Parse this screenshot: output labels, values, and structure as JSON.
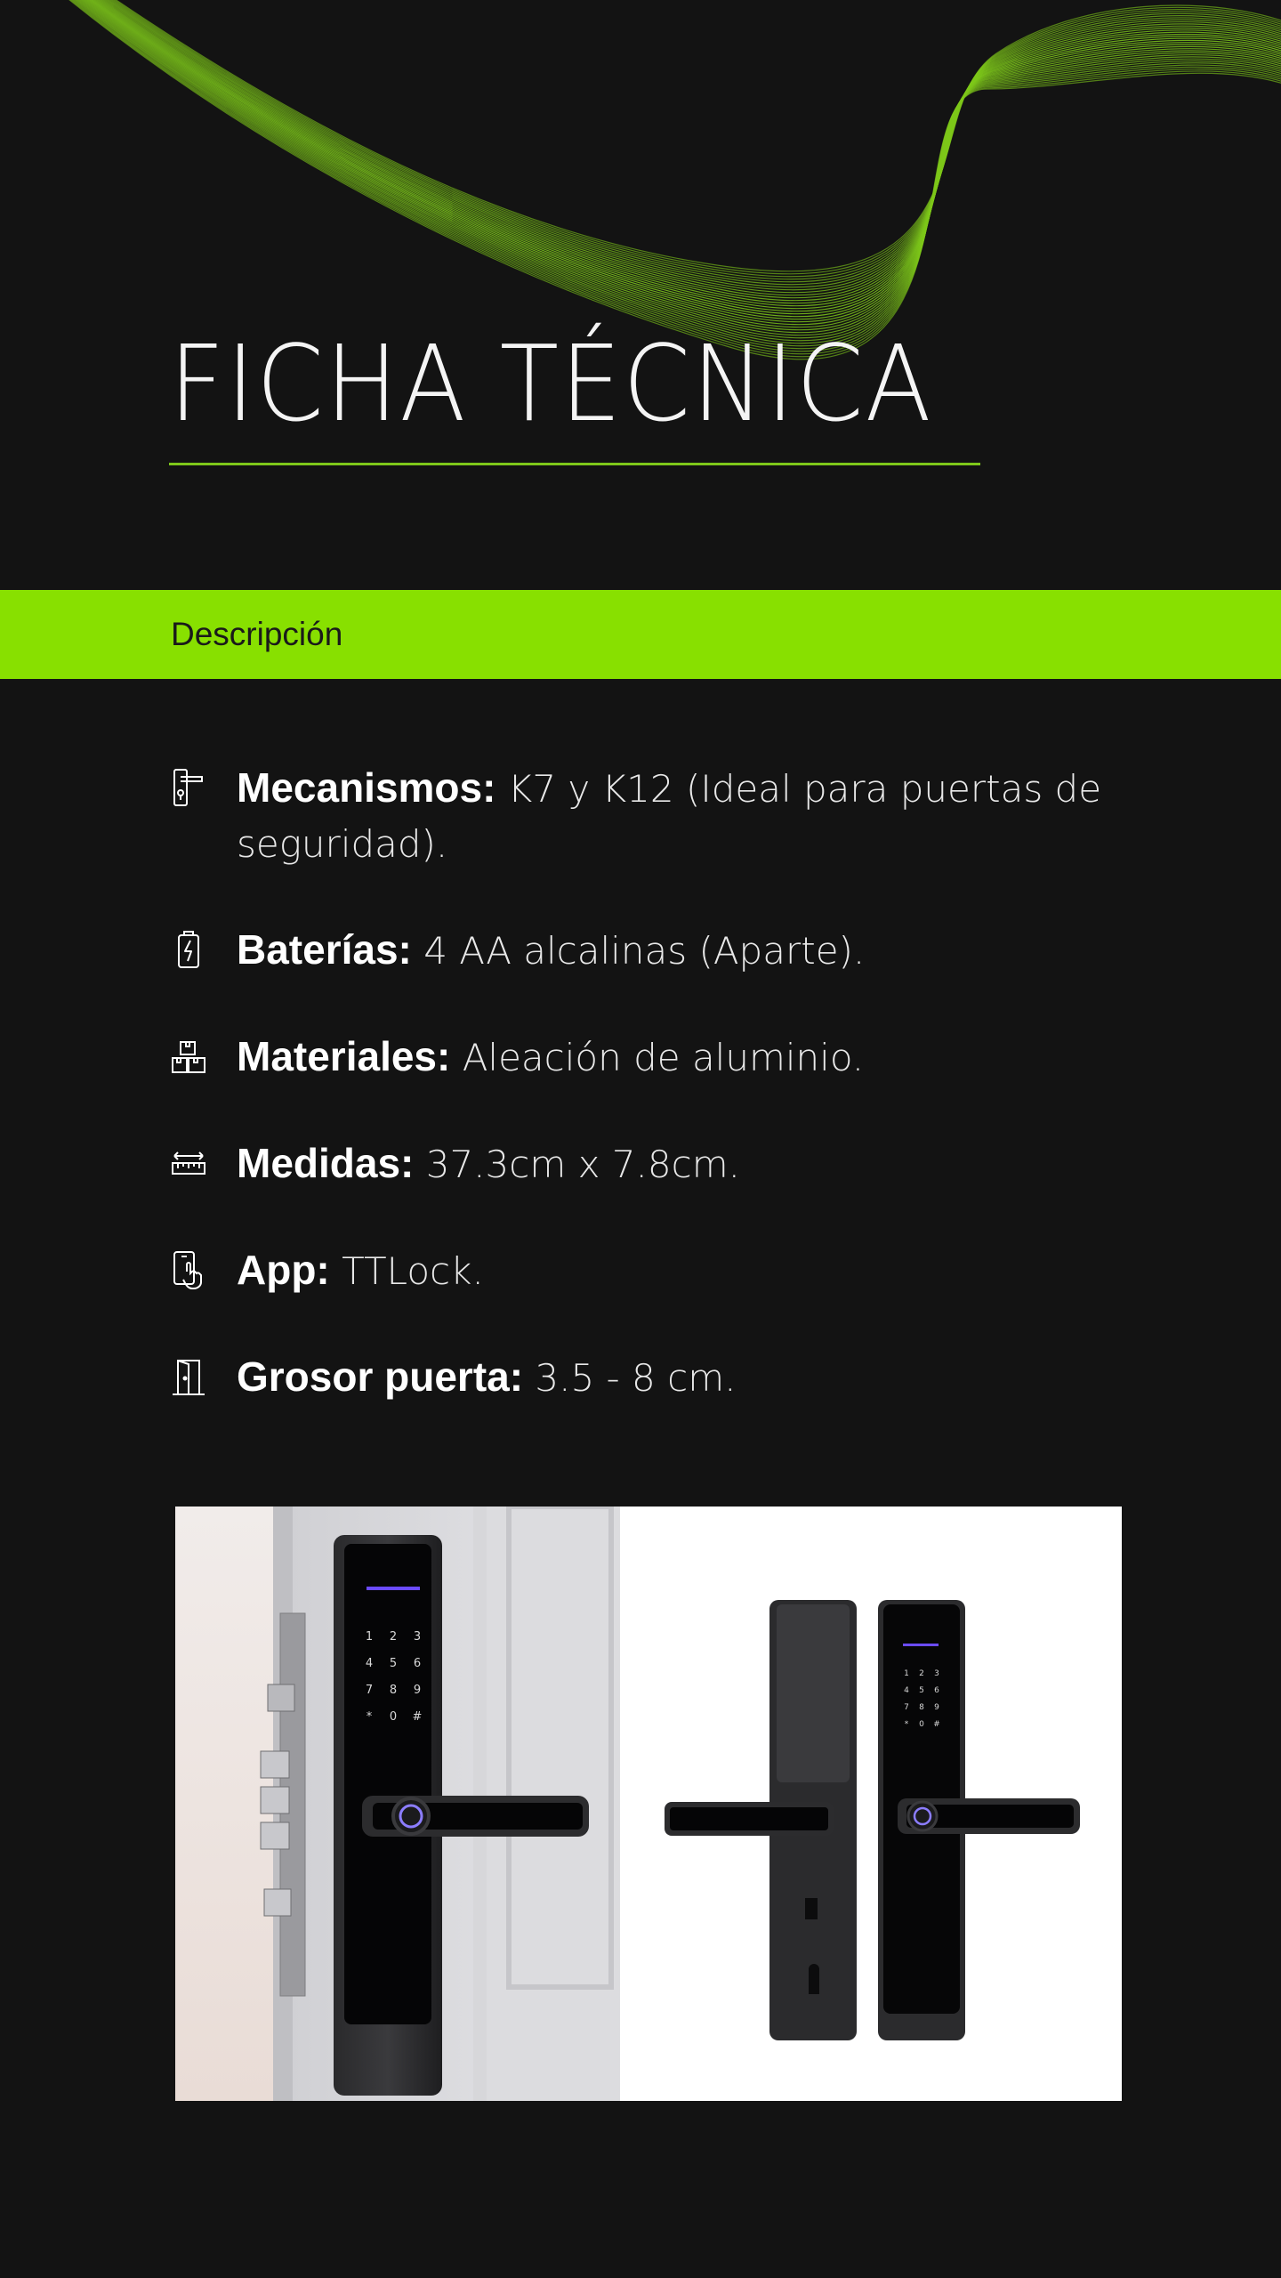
{
  "header": {
    "title": "FICHA TÉCNICA"
  },
  "section": {
    "label": "Descripción"
  },
  "specs": [
    {
      "icon": "door-handle-icon",
      "key": "Mecanismos:",
      "value": " K7 y K12 (Ideal para puertas de seguridad)."
    },
    {
      "icon": "battery-icon",
      "key": "Baterías:",
      "value": " 4 AA alcalinas (Aparte)."
    },
    {
      "icon": "materials-boxes-icon",
      "key": "Materiales:",
      "value": " Aleación de aluminio."
    },
    {
      "icon": "ruler-icon",
      "key": "Medidas:",
      "value": " 37.3cm x 7.8cm."
    },
    {
      "icon": "phone-touch-icon",
      "key": "App:",
      "value": " TTLock."
    },
    {
      "icon": "door-icon",
      "key": "Grosor puerta:",
      "value": " 3.5 - 8 cm."
    }
  ],
  "product_image": {
    "keypad_digits": [
      "1",
      "2",
      "3",
      "4",
      "5",
      "6",
      "7",
      "8",
      "9",
      "*",
      "0",
      "#"
    ]
  },
  "colors": {
    "background": "#131313",
    "accent": "#88e000",
    "wave_lines": "#7ec81a"
  }
}
